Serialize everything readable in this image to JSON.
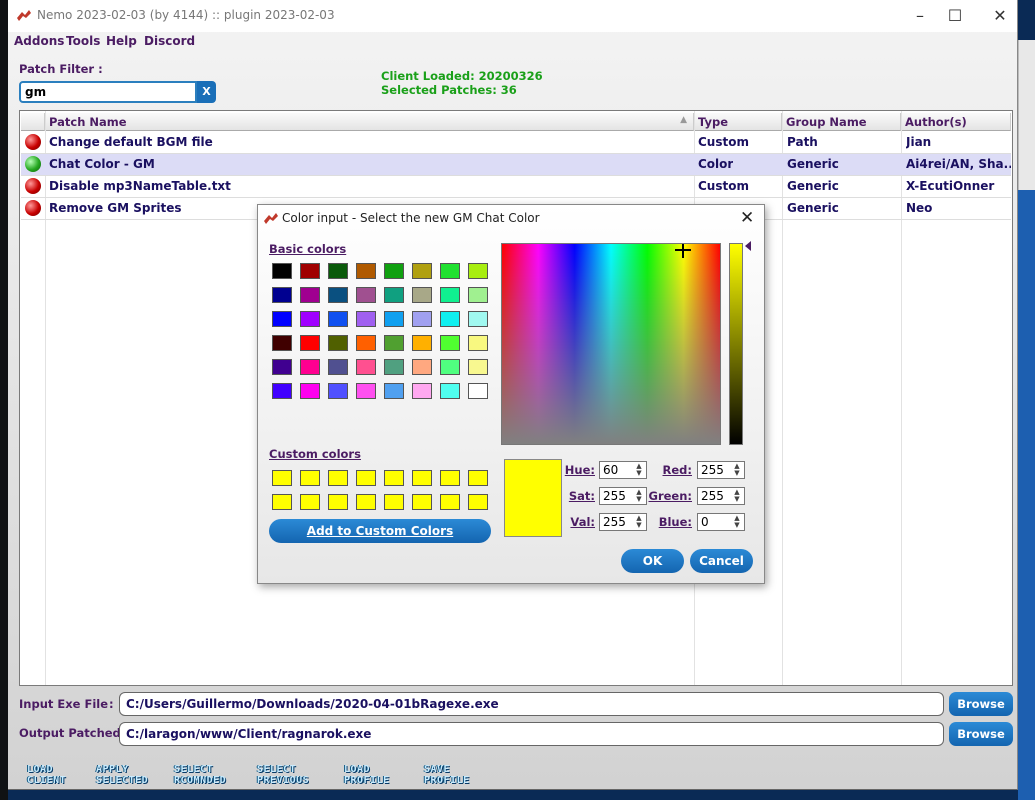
{
  "window": {
    "title": "Nemo 2023-02-03 (by 4144) :: plugin 2023-02-03"
  },
  "menu": [
    "Addons",
    "Tools",
    "Help",
    "Discord"
  ],
  "filter": {
    "label": "Patch Filter :",
    "value": "gm",
    "clear_label": "X"
  },
  "status": {
    "client": "Client Loaded: 20200326",
    "selected": "Selected Patches: 36"
  },
  "table": {
    "headers": [
      "Patch Name",
      "Type",
      "Group Name",
      "Author(s)"
    ],
    "rows": [
      {
        "name": "Change default BGM file",
        "type": "Custom",
        "group": "Path",
        "author": "Jian",
        "state": "red"
      },
      {
        "name": "Chat Color - GM",
        "type": "Color",
        "group": "Generic",
        "author": "Ai4rei/AN, Sha...",
        "state": "green"
      },
      {
        "name": "Disable mp3NameTable.txt",
        "type": "Custom",
        "group": "Generic",
        "author": "X-EcutiOnner",
        "state": "red"
      },
      {
        "name": "Remove GM Sprites",
        "type": "",
        "group": "Generic",
        "author": "Neo",
        "state": "red"
      }
    ]
  },
  "files": {
    "input_label": "Input Exe File",
    "input_sep": ":",
    "input_value": "C:/Users/Guillermo/Downloads/2020-04-01bRagexe.exe",
    "output_label": "Output Patched :",
    "output_value": "C:/laragon/www/Client/ragnarok.exe",
    "browse": "Browse"
  },
  "toolbar": [
    {
      "l1": "LOAD",
      "l2": "CLIENT"
    },
    {
      "l1": "APPLY",
      "l2": "SELECTED"
    },
    {
      "l1": "SELECT",
      "l2": "RCOMNDED"
    },
    {
      "l1": "SELECT",
      "l2": "PREVIOUS"
    },
    {
      "l1": "LOAD",
      "l2": "PROFILE"
    },
    {
      "l1": "SAVE",
      "l2": "PROFILE"
    }
  ],
  "dialog": {
    "title": "Color input - Select the new GM Chat Color",
    "basic_label": "Basic colors",
    "custom_label": "Custom colors",
    "add_label": "Add to Custom Colors",
    "hue_label": "Hue:",
    "hue": "60",
    "sat_label": "Sat:",
    "sat": "255",
    "val_label": "Val:",
    "val": "255",
    "red_label": "Red:",
    "red": "255",
    "green_label": "Green:",
    "green": "255",
    "blue_label": "Blue:",
    "blue": "0",
    "ok": "OK",
    "cancel": "Cancel",
    "basic_colors": [
      "#000000",
      "#a00000",
      "#0a5a0a",
      "#b05a00",
      "#10a010",
      "#b0a010",
      "#20e030",
      "#a8ee10",
      "#000090",
      "#a00090",
      "#0a5080",
      "#a05090",
      "#10a080",
      "#a8a888",
      "#10f090",
      "#a0f090",
      "#0000ff",
      "#a000ff",
      "#1050f0",
      "#a060f0",
      "#10a0f0",
      "#a0a0f0",
      "#10f0f0",
      "#a0f8f0",
      "#400000",
      "#ff0000",
      "#506000",
      "#ff6000",
      "#50a030",
      "#ffb000",
      "#50ff30",
      "#f8f880",
      "#400090",
      "#ff0090",
      "#505090",
      "#ff5090",
      "#50a080",
      "#ffa880",
      "#50ff80",
      "#f8f890",
      "#4000ff",
      "#ff00f0",
      "#5050ff",
      "#ff50f0",
      "#50a0f0",
      "#ffa8f0",
      "#50fff0",
      "#ffffff"
    ],
    "custom_color": "#ffff00"
  }
}
